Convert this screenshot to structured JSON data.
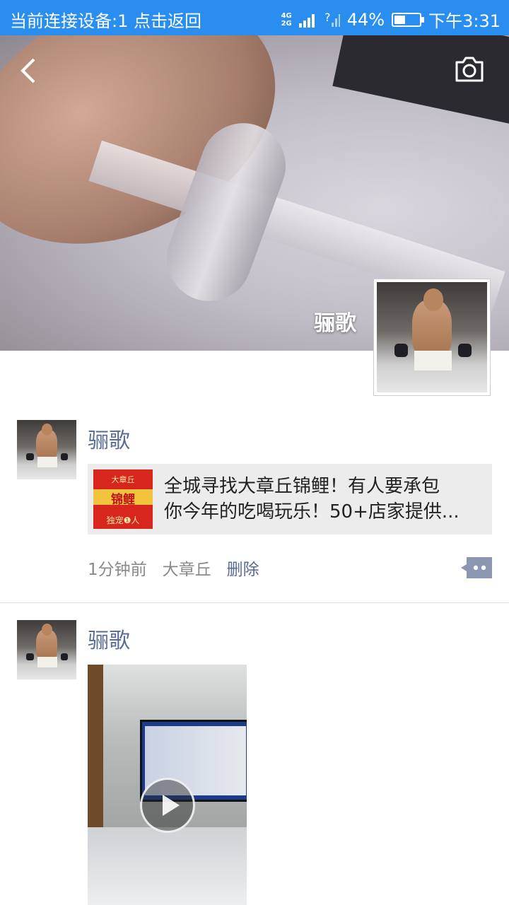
{
  "status_bar": {
    "left_text": "当前连接设备:1  点击返回",
    "network_top": "4G",
    "network_bottom": "2G",
    "battery_percent": "44%",
    "battery_level": 0.44,
    "time": "下午3:31"
  },
  "header": {
    "back_icon": "back-arrow-icon",
    "camera_icon": "camera-icon",
    "cover_name": "骊歌"
  },
  "posts": [
    {
      "author": "骊歌",
      "link_title_line1": "全城寻找大章丘锦鲤！有人要承包",
      "link_title_line2": "你今年的吃喝玩乐！50+店家提供...",
      "thumb_top": "大章丘",
      "thumb_main": "锦鲤",
      "thumb_bottom": "独宠❶人",
      "time": "1分钟前",
      "location": "大章丘",
      "delete_label": "删除"
    },
    {
      "author": "骊歌"
    }
  ],
  "colors": {
    "status_bar": "#2a8ef0",
    "name_link": "#576b95"
  }
}
